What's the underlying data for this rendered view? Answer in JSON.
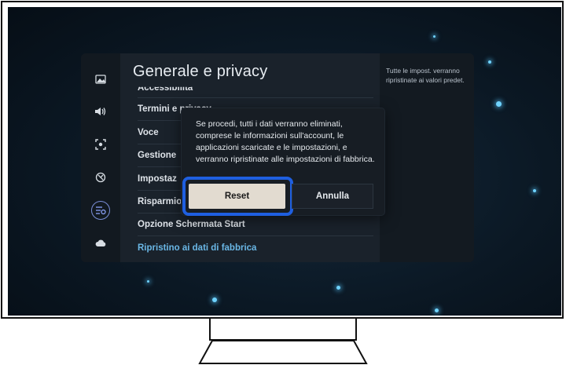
{
  "settings": {
    "title": "Generale e privacy",
    "description": "Tutte le impost. verranno ripristinate ai valori predet.",
    "menu": {
      "item_accessibility": "Accessibilità",
      "item_terms": "Termini e privacy",
      "item_voice": "Voce",
      "item_manage": "Gestione",
      "item_settings": "Impostaz",
      "item_energy": "Risparmio",
      "item_start_screen": "Opzione Schermata Start",
      "item_factory_reset": "Ripristino ai dati di fabbrica"
    },
    "rail_icons": [
      "picture-icon",
      "sound-icon",
      "connection-icon",
      "support-icon",
      "general-privacy-icon",
      "cloud-icon"
    ]
  },
  "dialog": {
    "message": "Se procedi, tutti i dati verranno eliminati, comprese le informazioni sull'account, le applicazioni scaricate e le impostazioni, e verranno ripristinate alle impostazioni di fabbrica.",
    "reset_label": "Reset",
    "cancel_label": "Annulla"
  },
  "colors": {
    "highlight_outline": "#1f5fe0",
    "reset_button": "#e2dbd0",
    "active_menu_text": "#6ab7e6"
  }
}
